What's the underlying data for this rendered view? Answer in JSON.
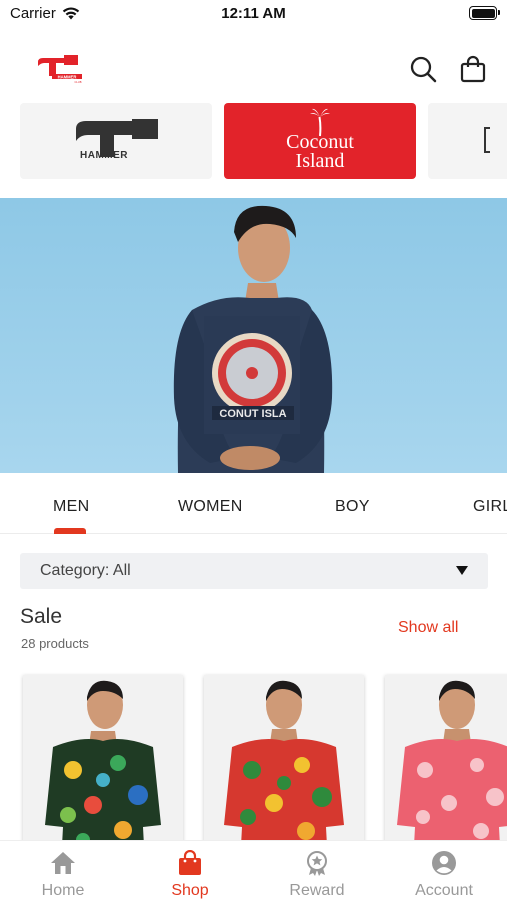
{
  "status_bar": {
    "carrier": "Carrier",
    "time": "12:11 AM"
  },
  "header": {
    "logo_text": "HAMMER"
  },
  "brands": [
    {
      "name": "HAMMER"
    },
    {
      "name": "Coconut Island"
    }
  ],
  "tabs": [
    {
      "label": "MEN",
      "active": true
    },
    {
      "label": "WOMEN"
    },
    {
      "label": "BOY"
    },
    {
      "label": "GIRL"
    }
  ],
  "hero": {
    "print_text": "CONUT ISLA"
  },
  "category": {
    "label": "Category: All"
  },
  "sale": {
    "title": "Sale",
    "count": "28 products",
    "show_all": "Show all"
  },
  "bottom_nav": [
    {
      "label": "Home",
      "icon": "home-icon"
    },
    {
      "label": "Shop",
      "icon": "shop-bag-icon",
      "active": true
    },
    {
      "label": "Reward",
      "icon": "reward-medal-icon"
    },
    {
      "label": "Account",
      "icon": "account-icon"
    }
  ],
  "colors": {
    "accent": "#e2381f",
    "brand_red": "#e2232a",
    "hero_sky": "#9fd0ea",
    "inactive": "#999999"
  }
}
